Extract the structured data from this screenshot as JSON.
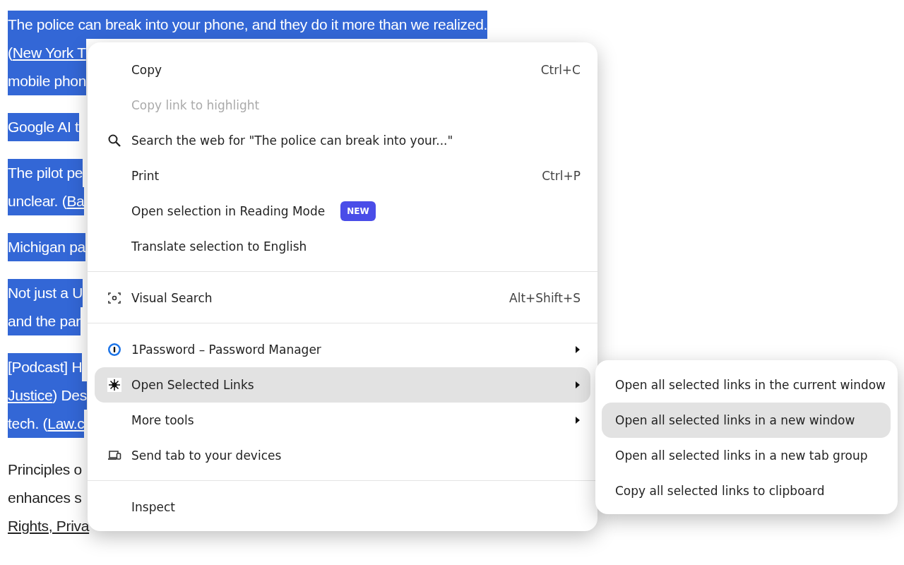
{
  "article": {
    "paragraphs": [
      {
        "selected": true,
        "lines": [
          [
            {
              "text": "The police can break into your phone, and they do it more than we realized.",
              "link": false
            }
          ],
          [
            {
              "text": "(",
              "link": false
            },
            {
              "text": "New York T",
              "link": true
            }
          ],
          [
            {
              "text": "mobile phon",
              "link": false
            }
          ]
        ]
      },
      {
        "selected": true,
        "lines": [
          [
            {
              "text": "Google AI t",
              "link": false
            }
          ]
        ]
      },
      {
        "selected": true,
        "lines": [
          [
            {
              "text": "The pilot pe",
              "link": false
            }
          ],
          [
            {
              "text": "unclear. (",
              "link": false
            },
            {
              "text": "Ba",
              "link": true
            }
          ]
        ]
      },
      {
        "selected": true,
        "lines": [
          [
            {
              "text": "Michigan pa",
              "link": false
            }
          ]
        ]
      },
      {
        "selected": true,
        "lines": [
          [
            {
              "text": "Not just a U",
              "link": false
            }
          ],
          [
            {
              "text": "and the par",
              "link": false
            }
          ]
        ]
      },
      {
        "selected": true,
        "lines": [
          [
            {
              "text": "[Podcast] H",
              "link": false
            }
          ],
          [
            {
              "text": "Justice",
              "link": true
            },
            {
              "text": ") Des",
              "link": false
            }
          ],
          [
            {
              "text": "tech. (",
              "link": false
            },
            {
              "text": "Law.c",
              "link": true
            }
          ]
        ]
      },
      {
        "selected": false,
        "lines": [
          [
            {
              "text": "Principles o",
              "link": false
            }
          ],
          [
            {
              "text": "enhances s",
              "link": false
            }
          ],
          [
            {
              "text": "Rights, Priva",
              "link": true
            }
          ]
        ]
      }
    ]
  },
  "context_menu": {
    "items": [
      {
        "kind": "item",
        "label": "Copy",
        "shortcut": "Ctrl+C",
        "disabled": false,
        "selected": false
      },
      {
        "kind": "item",
        "label": "Copy link to highlight",
        "disabled": true,
        "selected": false
      },
      {
        "kind": "item",
        "label": "Search the web for \"The police can break into your...\"",
        "disabled": false,
        "selected": false
      },
      {
        "kind": "item",
        "label": "Print",
        "shortcut": "Ctrl+P",
        "disabled": false,
        "selected": false
      },
      {
        "kind": "item",
        "label": "Open selection in Reading Mode",
        "badge": "NEW",
        "disabled": false,
        "selected": false
      },
      {
        "kind": "item",
        "label": "Translate selection to English",
        "disabled": false,
        "selected": false
      },
      {
        "kind": "separator"
      },
      {
        "kind": "item",
        "label": "Visual Search",
        "shortcut": "Alt+Shift+S",
        "disabled": false,
        "selected": false
      },
      {
        "kind": "separator"
      },
      {
        "kind": "item",
        "label": "1Password – Password Manager",
        "submenu": true,
        "disabled": false,
        "selected": false
      },
      {
        "kind": "item",
        "label": "Open Selected Links",
        "submenu": true,
        "disabled": false,
        "selected": true
      },
      {
        "kind": "item",
        "label": "More tools",
        "submenu": true,
        "disabled": false,
        "selected": false
      },
      {
        "kind": "item",
        "label": "Send tab to your devices",
        "disabled": false,
        "selected": false
      },
      {
        "kind": "separator"
      },
      {
        "kind": "item",
        "label": "Inspect",
        "disabled": false,
        "selected": false
      }
    ]
  },
  "submenu": {
    "items": [
      {
        "label": "Open all selected links in the current window",
        "selected": false
      },
      {
        "label": "Open all selected links in a new window",
        "selected": true
      },
      {
        "label": "Open all selected links in a new tab group",
        "selected": false
      },
      {
        "label": "Copy all selected links to clipboard",
        "selected": false
      }
    ]
  }
}
